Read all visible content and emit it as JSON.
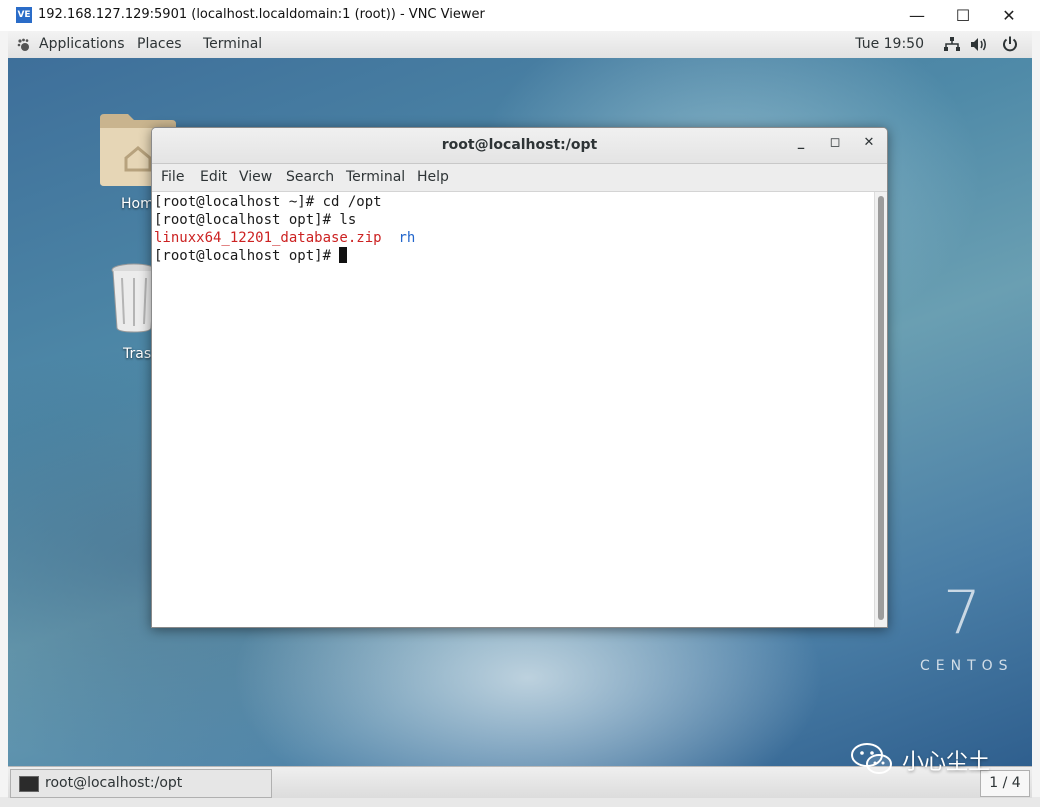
{
  "vnc": {
    "icon_text": "VE",
    "title": "192.168.127.129:5901 (localhost.localdomain:1 (root)) - VNC Viewer",
    "controls": {
      "minimize": "—",
      "maximize": "☐",
      "close": "✕"
    }
  },
  "topbar": {
    "applications": "Applications",
    "places": "Places",
    "terminal": "Terminal",
    "clock": "Tue 19:50",
    "icons": [
      "network-icon",
      "volume-icon",
      "power-icon"
    ]
  },
  "desktop": {
    "home_label": "Hom",
    "trash_label": "Tras",
    "brand_number": "7",
    "brand_text": "CENTOS"
  },
  "terminal": {
    "title": "root@localhost:/opt",
    "controls": {
      "minimize": "_",
      "maximize": "◻",
      "close": "✕"
    },
    "menu": [
      "File",
      "Edit",
      "View",
      "Search",
      "Terminal",
      "Help"
    ],
    "lines": [
      "[root@localhost ~]# cd /opt",
      "[root@localhost opt]# ls"
    ],
    "ls_output": {
      "zip": "linuxx64_12201_database.zip",
      "dir": "rh"
    },
    "prompt": "[root@localhost opt]# "
  },
  "taskbar": {
    "window_label": "root@localhost:/opt",
    "workspace": "1 / 4"
  },
  "watermark": {
    "text": "小心尘土"
  },
  "colors": {
    "zip_file": "#cc2222",
    "directory": "#2266cc"
  }
}
